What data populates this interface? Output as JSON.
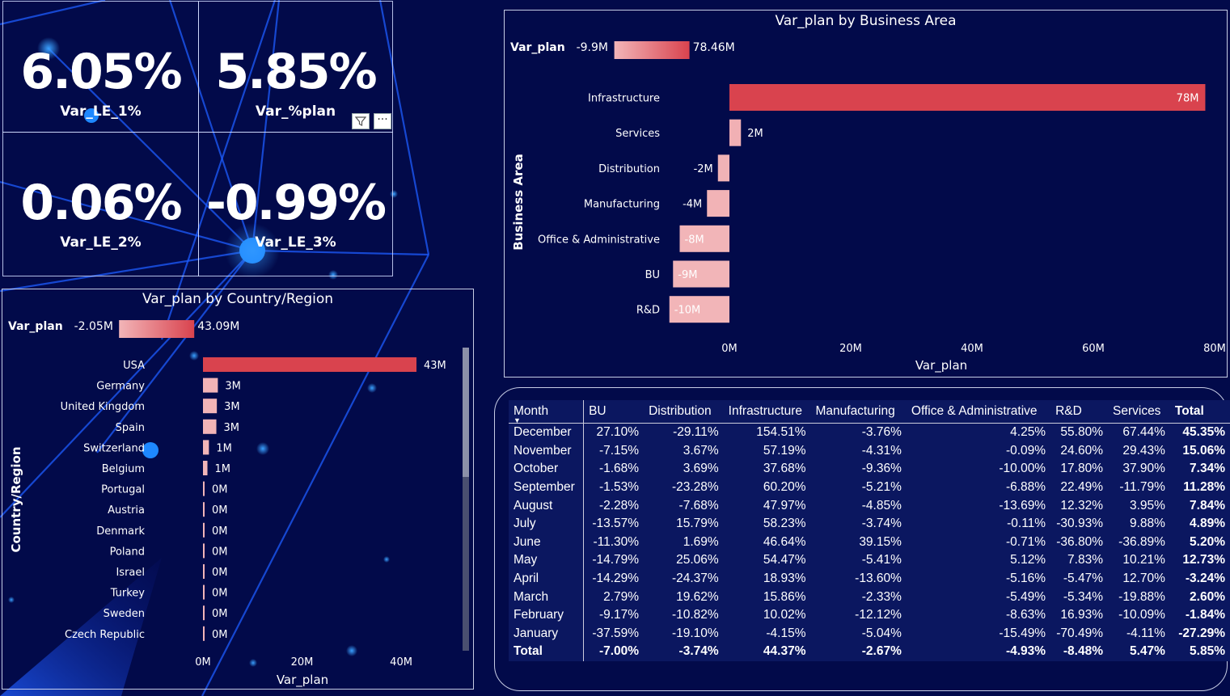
{
  "kpis": [
    {
      "value": "6.05%",
      "label": "Var_LE_1%"
    },
    {
      "value": "5.85%",
      "label": "Var_%plan"
    },
    {
      "value": "0.06%",
      "label": "Var_LE_2%"
    },
    {
      "value": "-0.99%",
      "label": "Var_LE_3%"
    }
  ],
  "visual_header": {
    "filter_icon": "filter-icon",
    "more_icon": "more-options-icon",
    "more_label": "···"
  },
  "chart_data": [
    {
      "id": "business_area",
      "type": "bar",
      "orientation": "horizontal",
      "title": "Var_plan by Business Area",
      "xlabel": "Var_plan",
      "ylabel": "Business Area",
      "legend": {
        "title": "Var_plan",
        "min": "-9.9M",
        "max": "78.46M",
        "colors": [
          "#f2b5b8",
          "#d9434e"
        ]
      },
      "categories": [
        "Infrastructure",
        "Services",
        "Distribution",
        "Manufacturing",
        "Office & Administrative",
        "BU",
        "R&D"
      ],
      "values": [
        78.46,
        1.9,
        -1.9,
        -3.7,
        -8.2,
        -9.3,
        -9.9
      ],
      "data_labels": [
        "78M",
        "2M",
        "-2M",
        "-4M",
        "-8M",
        "-9M",
        "-10M"
      ],
      "xticks": [
        "0M",
        "20M",
        "40M",
        "60M",
        "80M"
      ],
      "xlim": [
        -10,
        80
      ]
    },
    {
      "id": "country_region",
      "type": "bar",
      "orientation": "horizontal",
      "title": "Var_plan by Country/Region",
      "xlabel": "Var_plan",
      "ylabel": "Country/Region",
      "legend": {
        "title": "Var_plan",
        "min": "-2.05M",
        "max": "43.09M",
        "colors": [
          "#f2b5b8",
          "#d9434e"
        ]
      },
      "categories": [
        "USA",
        "Germany",
        "United Kingdom",
        "Spain",
        "Switzerland",
        "Belgium",
        "Portugal",
        "Austria",
        "Denmark",
        "Poland",
        "Israel",
        "Turkey",
        "Sweden",
        "Czech Republic"
      ],
      "values": [
        43.09,
        3.0,
        2.8,
        2.7,
        1.2,
        0.9,
        0.3,
        0.25,
        0.2,
        0.2,
        0.15,
        0.15,
        0.1,
        0.1
      ],
      "data_labels": [
        "43M",
        "3M",
        "3M",
        "3M",
        "1M",
        "1M",
        "0M",
        "0M",
        "0M",
        "0M",
        "0M",
        "0M",
        "0M",
        "0M"
      ],
      "xticks": [
        "0M",
        "20M",
        "40M"
      ],
      "xlim": [
        0,
        43.09
      ]
    }
  ],
  "matrix": {
    "columns": [
      "Month",
      "BU",
      "Distribution",
      "Infrastructure",
      "Manufacturing",
      "Office & Administrative",
      "R&D",
      "Services",
      "Total"
    ],
    "rows": [
      [
        "December",
        "27.10%",
        "-29.11%",
        "154.51%",
        "-3.76%",
        "4.25%",
        "55.80%",
        "67.44%",
        "45.35%"
      ],
      [
        "November",
        "-7.15%",
        "3.67%",
        "57.19%",
        "-4.31%",
        "-0.09%",
        "24.60%",
        "29.43%",
        "15.06%"
      ],
      [
        "October",
        "-1.68%",
        "3.69%",
        "37.68%",
        "-9.36%",
        "-10.00%",
        "17.80%",
        "37.90%",
        "7.34%"
      ],
      [
        "September",
        "-1.53%",
        "-23.28%",
        "60.20%",
        "-5.21%",
        "-6.88%",
        "22.49%",
        "-11.79%",
        "11.28%"
      ],
      [
        "August",
        "-2.28%",
        "-7.68%",
        "47.97%",
        "-4.85%",
        "-13.69%",
        "12.32%",
        "3.95%",
        "7.84%"
      ],
      [
        "July",
        "-13.57%",
        "15.79%",
        "58.23%",
        "-3.74%",
        "-0.11%",
        "-30.93%",
        "9.88%",
        "4.89%"
      ],
      [
        "June",
        "-11.30%",
        "1.69%",
        "46.64%",
        "39.15%",
        "-0.71%",
        "-36.80%",
        "-36.89%",
        "5.20%"
      ],
      [
        "May",
        "-14.79%",
        "25.06%",
        "54.47%",
        "-5.41%",
        "5.12%",
        "7.83%",
        "10.21%",
        "12.73%"
      ],
      [
        "April",
        "-14.29%",
        "-24.37%",
        "18.93%",
        "-13.60%",
        "-5.16%",
        "-5.47%",
        "12.70%",
        "-3.24%"
      ],
      [
        "March",
        "2.79%",
        "19.62%",
        "15.86%",
        "-2.33%",
        "-5.49%",
        "-5.34%",
        "-19.88%",
        "2.60%"
      ],
      [
        "February",
        "-9.17%",
        "-10.82%",
        "10.02%",
        "-12.12%",
        "-8.63%",
        "16.93%",
        "-10.09%",
        "-1.84%"
      ],
      [
        "January",
        "-37.59%",
        "-19.10%",
        "-4.15%",
        "-5.04%",
        "-15.49%",
        "-70.49%",
        "-4.11%",
        "-27.29%"
      ]
    ],
    "total_row": [
      "Total",
      "-7.00%",
      "-3.74%",
      "44.37%",
      "-2.67%",
      "-4.93%",
      "-8.48%",
      "5.47%",
      "5.85%"
    ]
  },
  "colors": {
    "background": "#020a4a",
    "bar_high": "#d9434e",
    "bar_low": "#f2b5b8"
  }
}
